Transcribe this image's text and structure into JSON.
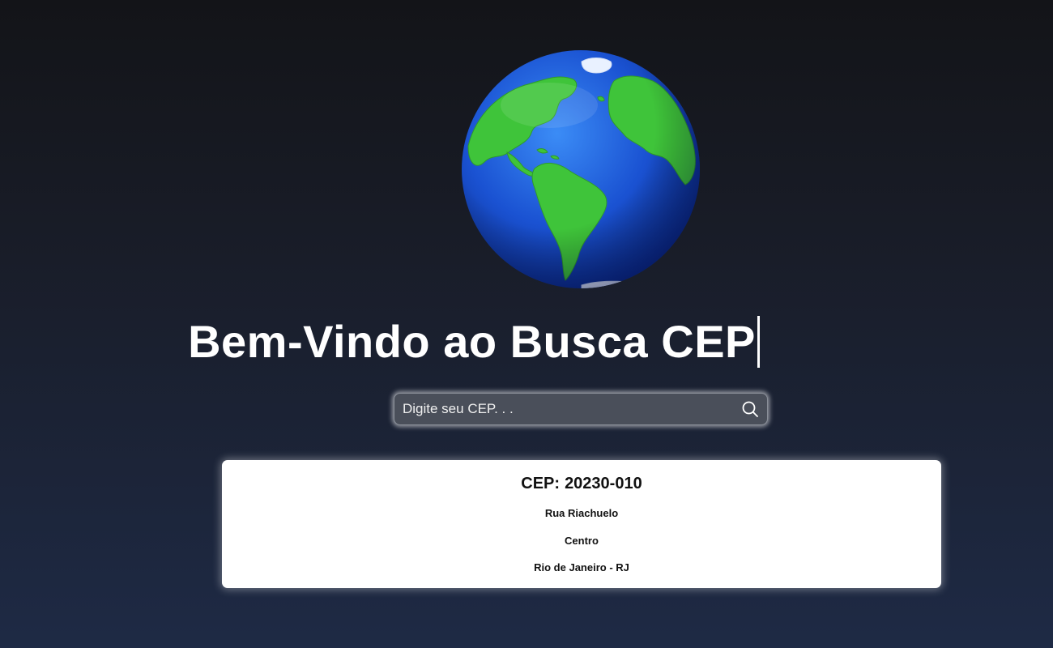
{
  "header": {
    "logo_icon": "globe-icon",
    "title": "Bem-Vindo ao Busca CEP"
  },
  "search": {
    "placeholder": "Digite seu CEP. . .",
    "value": "",
    "button_icon": "search-icon"
  },
  "result": {
    "cep_label": "CEP:",
    "cep_value": "20230-010",
    "street": "Rua Riachuelo",
    "district": "Centro",
    "city_state": "Rio de Janeiro - RJ"
  },
  "colors": {
    "background_top": "#131418",
    "background_bottom": "#1e2a45",
    "ocean": "#1f56d6",
    "land": "#43c83c",
    "card": "#ffffff"
  }
}
